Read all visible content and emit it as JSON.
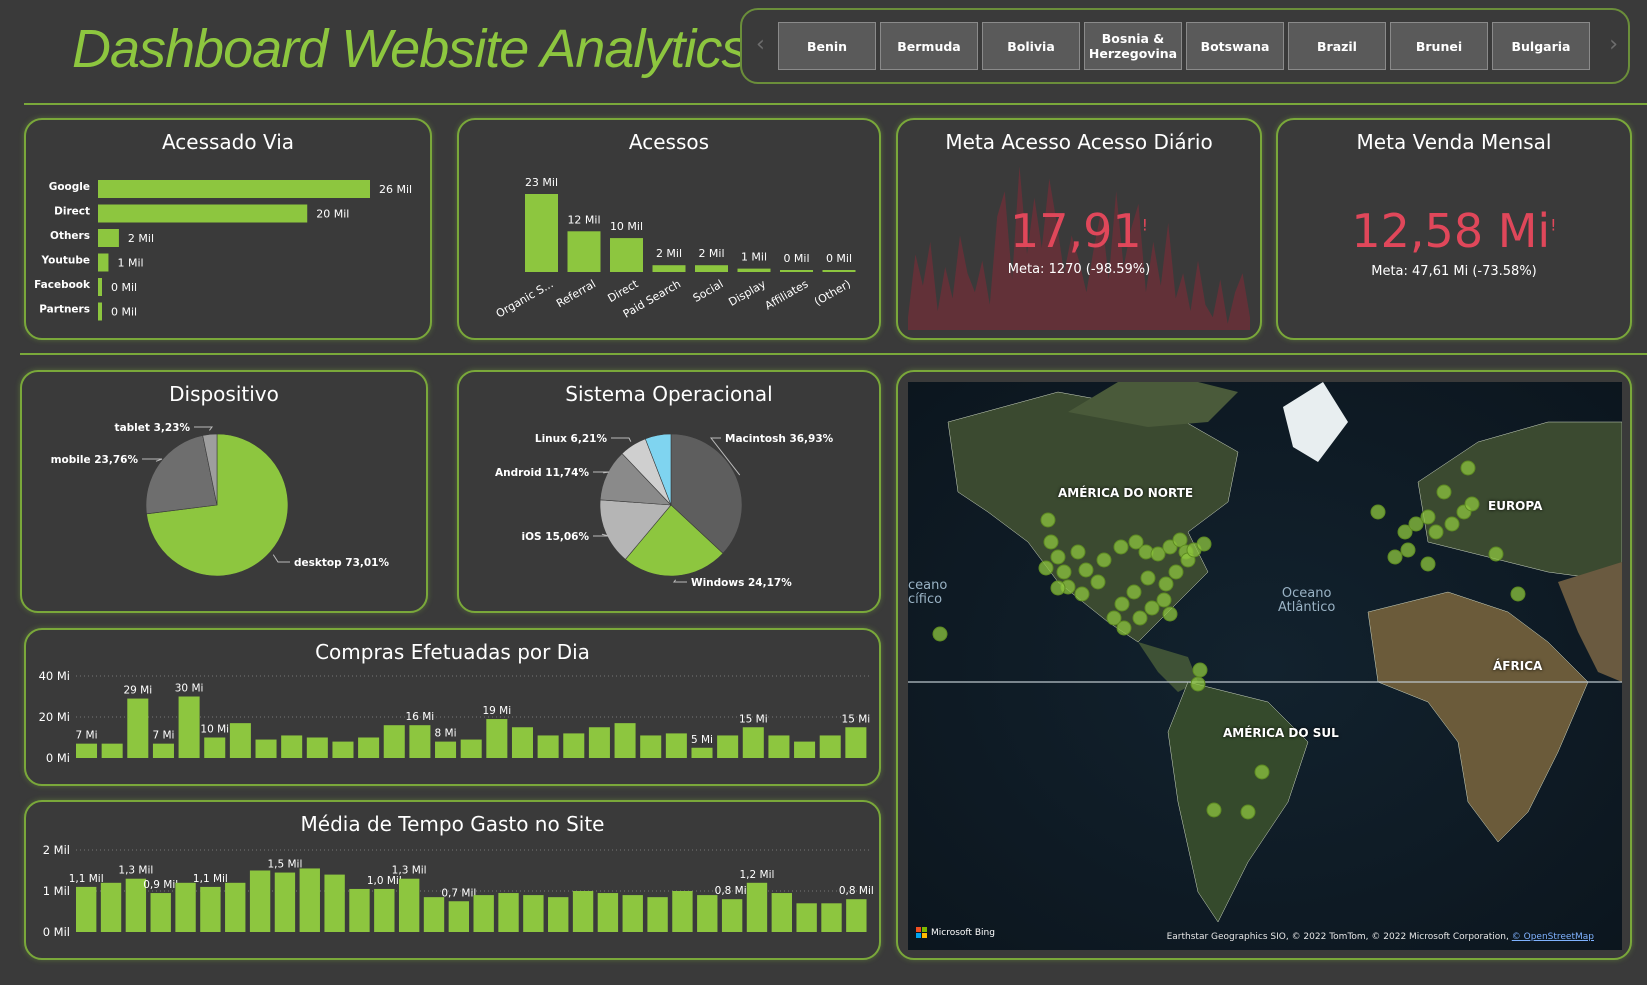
{
  "header": {
    "title": "Dashboard Website Analytics"
  },
  "slicer": {
    "prev_icon": "chevron-left-icon",
    "next_icon": "chevron-right-icon",
    "items": [
      "Benin",
      "Bermuda",
      "Bolivia",
      "Bosnia & Herzegovina",
      "Botswana",
      "Brazil",
      "Brunei",
      "Bulgaria"
    ]
  },
  "colors": {
    "accent": "#8dc63f",
    "kpi": "#e0475a",
    "background": "#3a3a3a"
  },
  "kpi1": {
    "title": "Meta Acesso Acesso Diário",
    "value": "17,91",
    "meta": "Meta: 1270 (-98.59%)",
    "warning_icon": "alert-icon"
  },
  "kpi2": {
    "title": "Meta Venda Mensal",
    "value": "12,58 Mi",
    "meta": "Meta: 47,61 Mi (-73.58%)",
    "warning_icon": "alert-icon"
  },
  "map": {
    "labels": {
      "na": "AMÉRICA DO NORTE",
      "eu": "EUROPA",
      "af": "ÁFRICA",
      "sa": "AMÉRICA DO SUL"
    },
    "ocean_atl": "Oceano\nAtlântico",
    "ocean_pac": "ceano\ncífico",
    "bing": "Microsoft Bing",
    "credit": "Earthstar Geographics SIO, © 2022 TomTom, © 2022 Microsoft Corporation,",
    "credit_link": "© OpenStreetMap"
  },
  "chart_data": [
    {
      "type": "bar",
      "orientation": "horizontal",
      "title": "Acessado Via",
      "categories": [
        "Google",
        "Direct",
        "Others",
        "Youtube",
        "Facebook",
        "Partners"
      ],
      "values": [
        26,
        20,
        2,
        1,
        0,
        0
      ],
      "data_labels": [
        "26 Mil",
        "20 Mil",
        "2 Mil",
        "1 Mil",
        "0 Mil",
        "0 Mil"
      ]
    },
    {
      "type": "bar",
      "title": "Acessos",
      "categories": [
        "Organic S...",
        "Referral",
        "Direct",
        "Paid Search",
        "Social",
        "Display",
        "Affiliates",
        "(Other)"
      ],
      "values": [
        23,
        12,
        10,
        2,
        2,
        1,
        0,
        0
      ],
      "data_labels": [
        "23 Mil",
        "12 Mil",
        "10 Mil",
        "2 Mil",
        "2 Mil",
        "1 Mil",
        "0 Mil",
        "0 Mil"
      ]
    },
    {
      "type": "area",
      "values": [
        2,
        12,
        7,
        14,
        3,
        10,
        5,
        15,
        9,
        6,
        11,
        4,
        18,
        22,
        8,
        26,
        12,
        21,
        13,
        24,
        17,
        9,
        15,
        11,
        6,
        13,
        19,
        8,
        22,
        10,
        16,
        20,
        6,
        14,
        7,
        17,
        5,
        9,
        3,
        11,
        4,
        2,
        8,
        1,
        6,
        9,
        2
      ]
    },
    {
      "type": "area",
      "values": [
        0,
        0,
        0,
        0,
        0,
        0,
        0,
        0,
        0,
        0
      ]
    },
    {
      "type": "pie",
      "title": "Dispositivo",
      "slices": [
        {
          "label": "desktop",
          "value": 73.01,
          "text": "desktop 73,01%",
          "color": "#8dc63f"
        },
        {
          "label": "mobile",
          "value": 23.76,
          "text": "mobile 23,76%",
          "color": "#6e6e6e"
        },
        {
          "label": "tablet",
          "value": 3.23,
          "text": "tablet 3,23%",
          "color": "#9e9e9e"
        }
      ]
    },
    {
      "type": "pie",
      "title": "Sistema Operacional",
      "slices": [
        {
          "label": "Macintosh",
          "value": 36.93,
          "text": "Macintosh 36,93%",
          "color": "#5e5e5e"
        },
        {
          "label": "Windows",
          "value": 24.17,
          "text": "Windows 24,17%",
          "color": "#8dc63f"
        },
        {
          "label": "iOS",
          "value": 15.06,
          "text": "iOS 15,06%",
          "color": "#b5b5b5"
        },
        {
          "label": "Android",
          "value": 11.74,
          "text": "Android 11,74%",
          "color": "#8a8a8a"
        },
        {
          "label": "Linux",
          "value": 6.21,
          "text": "Linux 6,21%",
          "color": "#cfcfcf"
        },
        {
          "label": "other",
          "value": 5.89,
          "text": "",
          "color": "#7fd4f0"
        }
      ]
    },
    {
      "type": "bar",
      "title": "Compras Efetuadas por Dia",
      "yticks": [
        "40 Mi",
        "20 Mi",
        "0 Mi"
      ],
      "ylim": [
        0,
        40
      ],
      "values": [
        7,
        7,
        29,
        7,
        30,
        10,
        17,
        9,
        11,
        10,
        8,
        10,
        16,
        16,
        8,
        9,
        19,
        15,
        11,
        12,
        15,
        17,
        11,
        12,
        5,
        11,
        15,
        11,
        8,
        11,
        15
      ],
      "data_labels": {
        "0": "7 Mi",
        "2": "29 Mi",
        "3": "7 Mi",
        "4": "30 Mi",
        "5": "10 Mi",
        "13": "16 Mi",
        "14": "8 Mi",
        "16": "19 Mi",
        "24": "5 Mi",
        "26": "15 Mi",
        "30": "15 Mi"
      }
    },
    {
      "type": "bar",
      "title": "Média de Tempo Gasto no Site",
      "yticks": [
        "2 Mil",
        "1 Mil",
        "0 Mil"
      ],
      "ylim": [
        0,
        2
      ],
      "values": [
        1.1,
        1.2,
        1.3,
        0.95,
        1.2,
        1.1,
        1.2,
        1.5,
        1.45,
        1.55,
        1.4,
        1.05,
        1.05,
        1.3,
        0.85,
        0.75,
        0.9,
        0.95,
        0.9,
        0.85,
        1.0,
        0.95,
        0.9,
        0.85,
        1.0,
        0.9,
        0.8,
        1.2,
        0.95,
        0.7,
        0.7,
        0.8
      ],
      "data_labels": {
        "0": "1,1 Mil",
        "2": "1,3 Mil",
        "3": "0,9 Mil",
        "5": "1,1 Mil",
        "8": "1,5 Mil",
        "12": "1,0 Mil",
        "13": "1,3 Mil",
        "15": "0,7 Mil",
        "26": "0,8 Mil",
        "27": "1,2 Mil",
        "31": "0,8 Mil"
      }
    }
  ]
}
